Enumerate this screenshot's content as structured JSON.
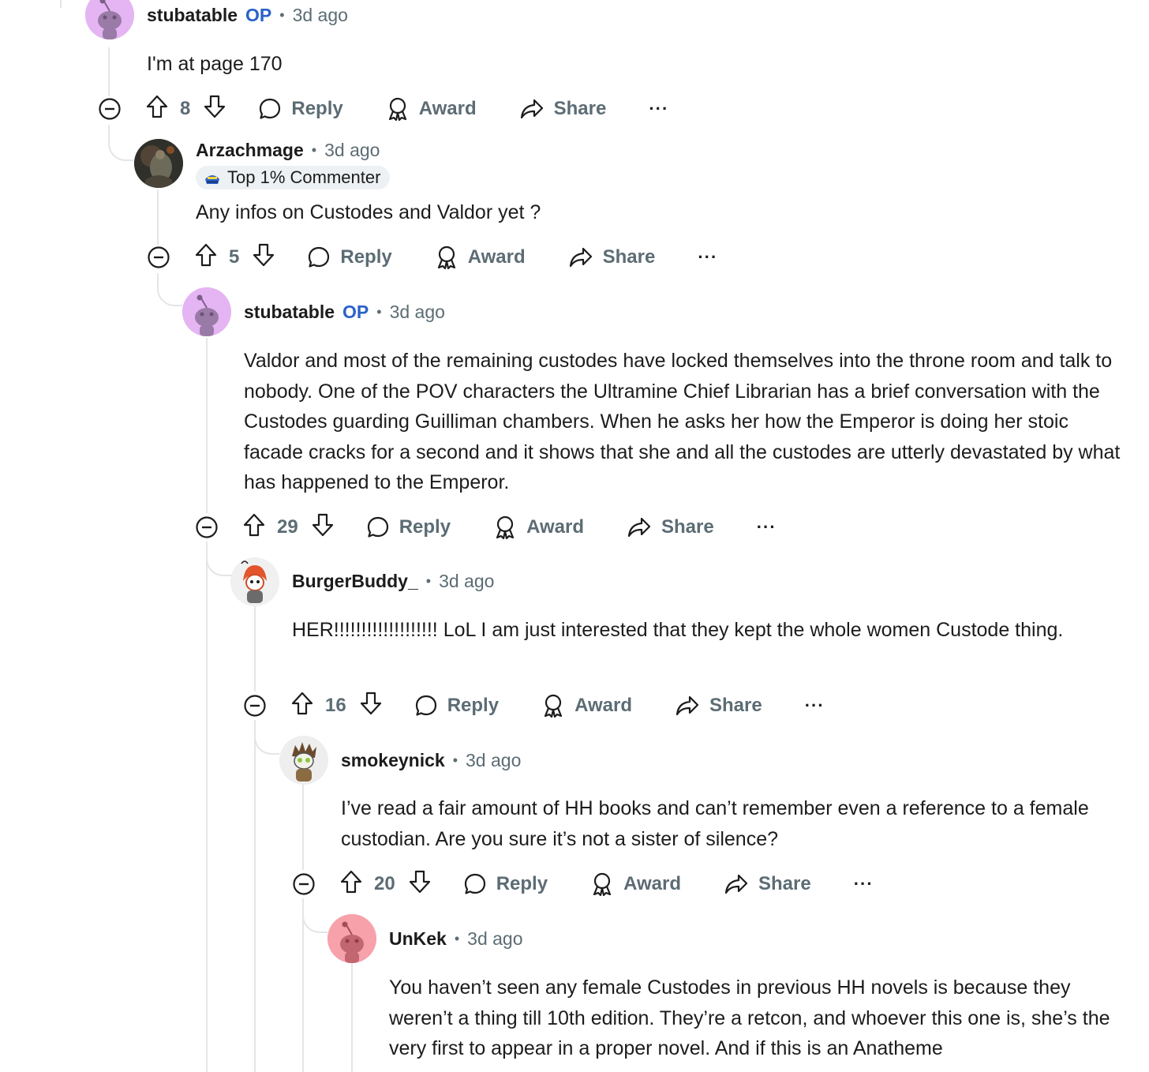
{
  "comments": [
    {
      "author": "stubatable",
      "op_label": "OP",
      "time": "3d ago",
      "body": "I'm at page 170",
      "votes": "8",
      "reply_label": "Reply",
      "award_label": "Award",
      "share_label": "Share",
      "more_label": "···",
      "avatar_color": "#e4b5f2"
    },
    {
      "author": "Arzachmage",
      "time": "3d ago",
      "flair": "Top 1% Commenter",
      "body": "Any infos on Custodes and Valdor yet ?",
      "votes": "5",
      "reply_label": "Reply",
      "award_label": "Award",
      "share_label": "Share",
      "more_label": "···",
      "avatar_color": "#3a3a34"
    },
    {
      "author": "stubatable",
      "op_label": "OP",
      "time": "3d ago",
      "body": "Valdor and most of the remaining custodes have locked themselves into the throne room and talk to nobody. One of the POV characters the Ultramine Chief Librarian has a brief conversation with the Custodes guarding Guilliman chambers. When he asks her how the Emperor is doing her stoic facade cracks for a second and it shows that she and all the custodes are utterly devastated by what has happened to the Emperor.",
      "votes": "29",
      "reply_label": "Reply",
      "award_label": "Award",
      "share_label": "Share",
      "more_label": "···",
      "avatar_color": "#e4b5f2"
    },
    {
      "author": "BurgerBuddy_",
      "time": "3d ago",
      "body": "HER!!!!!!!!!!!!!!!!!!! LoL I am just interested that they kept the whole women Custode thing.",
      "votes": "16",
      "reply_label": "Reply",
      "award_label": "Award",
      "share_label": "Share",
      "more_label": "···",
      "avatar_color": "#f4f4f4"
    },
    {
      "author": "smokeynick",
      "time": "3d ago",
      "body": "I’ve read a fair amount of HH books and can’t remember even a reference to a female custodian. Are you sure it’s not a sister of silence?",
      "votes": "20",
      "reply_label": "Reply",
      "award_label": "Award",
      "share_label": "Share",
      "more_label": "···",
      "avatar_color": "#f1f1f1"
    },
    {
      "author": "UnKek",
      "time": "3d ago",
      "body": "You haven’t seen any female Custodes in previous HH novels is because they weren’t a thing till 10th edition. They’re a retcon, and whoever this one is, she’s the very first to appear in a proper novel. And if this is an Anatheme",
      "avatar_color": "#f7a2ab"
    }
  ],
  "colors": {
    "text": "#1c1c1c",
    "muted": "#5c6c74",
    "op": "#2a62c9",
    "thread_line": "#e3e5e8",
    "flair_bg": "#eef1f3"
  }
}
